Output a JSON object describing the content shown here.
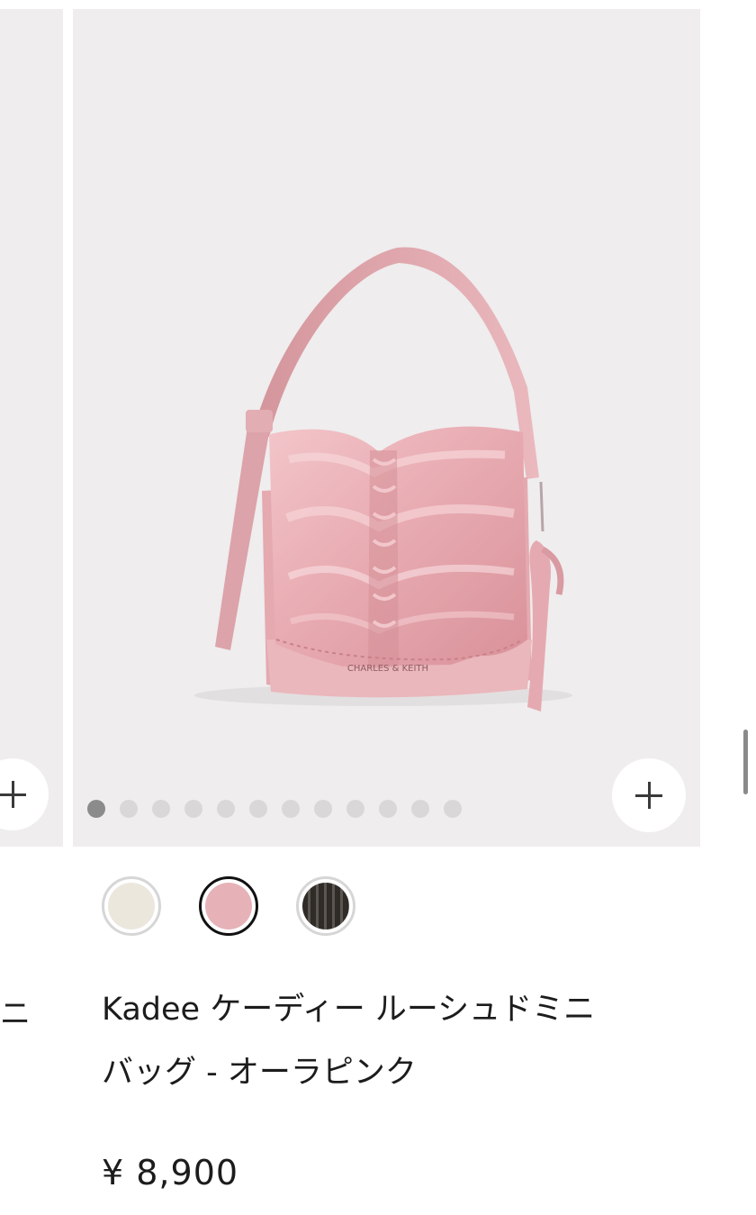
{
  "product": {
    "name_line1": "Kadee ケーディー ルーシュドミニ",
    "name_line2": "バッグ - オーラピンク",
    "price": "¥ 8,900",
    "logo_text": "CHARLES & KEITH"
  },
  "left_card": {
    "partial_text": "ニ"
  },
  "carousel": {
    "total_images": 12,
    "active_index": 0
  },
  "swatches": [
    {
      "name": "cream",
      "color": "#ece7dd",
      "selected": false
    },
    {
      "name": "aura-pink",
      "color": "#e6b2b8",
      "selected": true
    },
    {
      "name": "dark-check",
      "color": "#3a3630",
      "selected": false
    }
  ],
  "icons": {
    "add": "plus-icon"
  }
}
